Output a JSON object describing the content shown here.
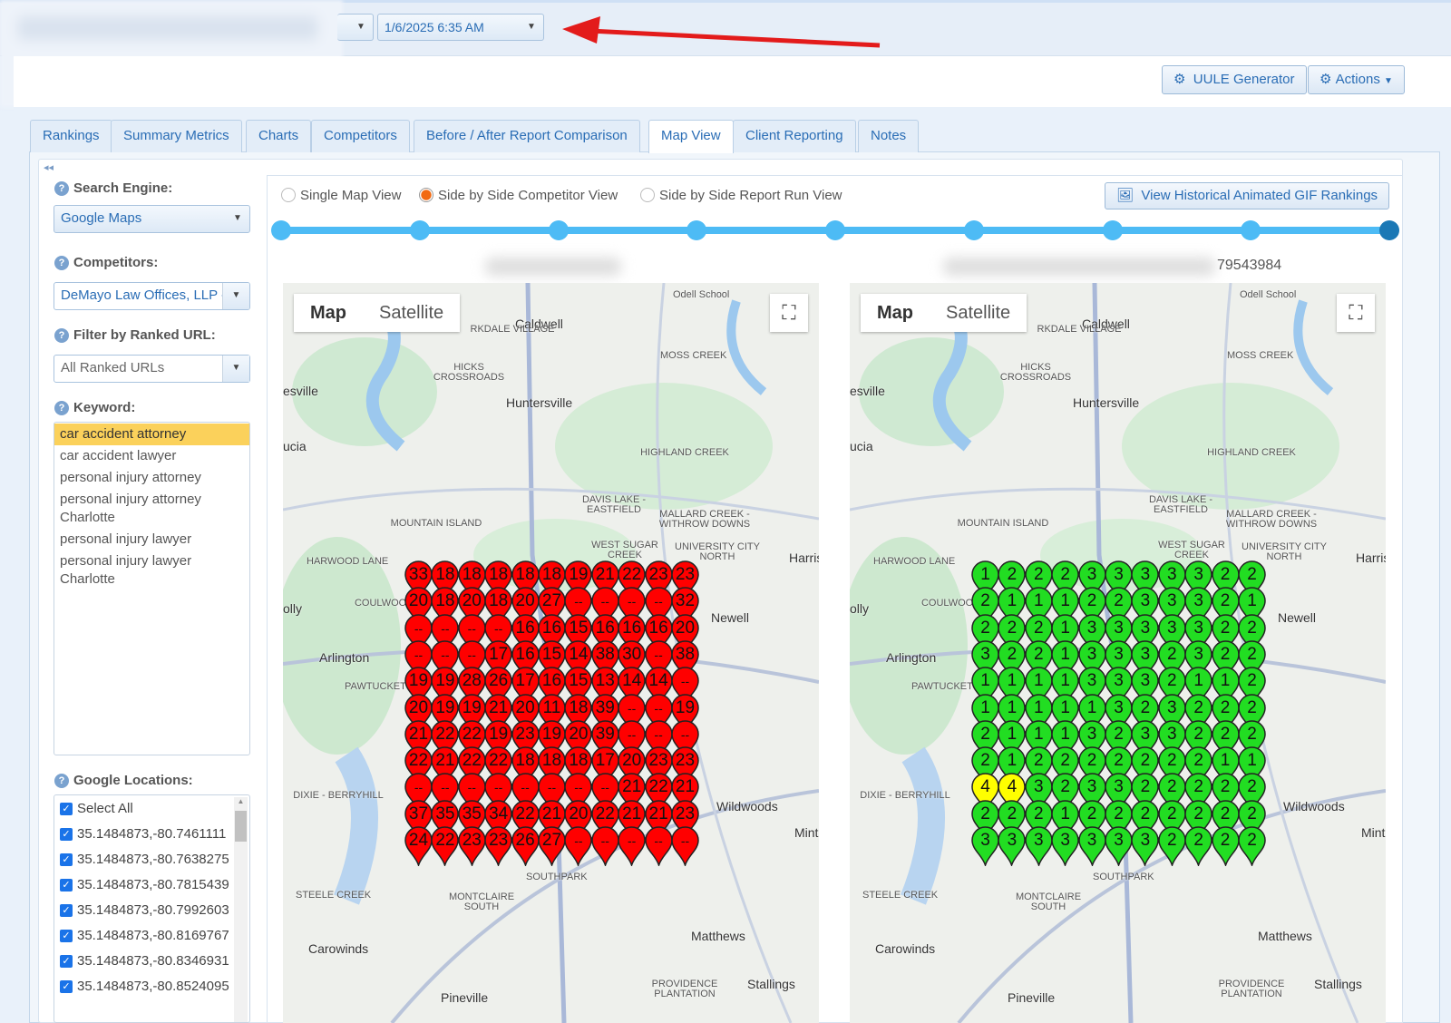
{
  "topbar": {
    "report_date": "1/6/2025 6:35 AM"
  },
  "header": {
    "uule_button": "UULE Generator",
    "actions_button": "Actions"
  },
  "tabs": [
    "Rankings",
    "Summary Metrics",
    "Charts",
    "Competitors",
    "Before / After Report Comparison",
    "Map View",
    "Client Reporting",
    "Notes"
  ],
  "active_tab": "Map View",
  "sidebar": {
    "search_engine_label": "Search Engine:",
    "search_engine_value": "Google Maps",
    "competitors_label": "Competitors:",
    "competitors_value": "DeMayo Law Offices, LLP -",
    "ranked_url_label": "Filter by Ranked URL:",
    "ranked_url_value": "All Ranked URLs",
    "keyword_label": "Keyword:",
    "keywords": [
      "car accident attorney",
      "car accident lawyer",
      "personal injury attorney",
      "personal injury attorney Charlotte",
      "personal injury lawyer",
      "personal injury lawyer Charlotte"
    ],
    "selected_keyword": "car accident attorney",
    "locations_label": "Google Locations:",
    "select_all": "Select All",
    "locations": [
      "35.1484873,-80.7461111",
      "35.1484873,-80.7638275",
      "35.1484873,-80.7815439",
      "35.1484873,-80.7992603",
      "35.1484873,-80.8169767",
      "35.1484873,-80.8346931",
      "35.1484873,-80.8524095"
    ]
  },
  "view": {
    "options": [
      "Single Map View",
      "Side by Side Competitor View",
      "Side by Side Report Run View"
    ],
    "selected": "Side by Side Competitor View",
    "gif_button": "View Historical Animated GIF Rankings",
    "timeline_points": 9,
    "timeline_selected": 9
  },
  "map_controls": {
    "map": "Map",
    "satellite": "Satellite"
  },
  "map_labels": [
    "Odell School",
    "Caldwell",
    "MOSS CREEK",
    "HICKS CROSSROADS",
    "Huntersville",
    "esville",
    "HIGHLAND CREEK",
    "DAVIS LAKE - EASTFIELD",
    "MALLARD CREEK - WITHROW DOWNS",
    "MOUNTAIN ISLAND",
    "WEST SUGAR CREEK",
    "UNIVERSITY CITY NORTH",
    "HARWOOD LANE",
    "Harris",
    "Newell",
    "Arlington",
    "Wildwoods",
    "DIXIE - BERRYHILL",
    "STEELE CREEK",
    "MONTCLAIRE SOUTH",
    "SOUTHPARK",
    "Matthews",
    "Carowinds",
    "PROVIDENCE PLANTATION",
    "Stallings",
    "Pineville",
    "ucia",
    "olly",
    "COULWOOD WEST",
    "PAWTUCKET",
    "Mint",
    "RKDALE VILLAGE"
  ],
  "maps": [
    {
      "caption": "",
      "pin_color": "#ff0000",
      "grid": [
        [
          "33",
          "18",
          "18",
          "18",
          "18",
          "18",
          "19",
          "21",
          "22",
          "23",
          "23"
        ],
        [
          "20",
          "18",
          "20",
          "18",
          "20",
          "27",
          "--",
          "--",
          "--",
          "--",
          "32"
        ],
        [
          "--",
          "--",
          "--",
          "--",
          "16",
          "16",
          "15",
          "16",
          "16",
          "16",
          "20"
        ],
        [
          "--",
          "--",
          "--",
          "17",
          "16",
          "15",
          "14",
          "38",
          "30",
          "--",
          "38"
        ],
        [
          "19",
          "19",
          "28",
          "26",
          "17",
          "16",
          "15",
          "13",
          "14",
          "14",
          "--"
        ],
        [
          "20",
          "19",
          "19",
          "21",
          "20",
          "11",
          "18",
          "39",
          "--",
          "--",
          "19"
        ],
        [
          "21",
          "22",
          "22",
          "19",
          "23",
          "19",
          "20",
          "39",
          "--",
          "--",
          "--"
        ],
        [
          "22",
          "21",
          "22",
          "22",
          "18",
          "18",
          "18",
          "17",
          "20",
          "23",
          "23"
        ],
        [
          "--",
          "--",
          "--",
          "--",
          "--",
          "--",
          "--",
          "--",
          "21",
          "22",
          "21"
        ],
        [
          "37",
          "35",
          "35",
          "34",
          "22",
          "21",
          "20",
          "22",
          "21",
          "21",
          "23"
        ],
        [
          "24",
          "22",
          "23",
          "23",
          "26",
          "27",
          "--",
          "--",
          "--",
          "--",
          "--"
        ]
      ]
    },
    {
      "caption": "79543984",
      "pin_color": "#22dd22",
      "pin_color_rank4": "#ffff00",
      "grid": [
        [
          "1",
          "2",
          "2",
          "2",
          "3",
          "3",
          "3",
          "3",
          "3",
          "2",
          "2"
        ],
        [
          "2",
          "1",
          "1",
          "1",
          "2",
          "2",
          "3",
          "3",
          "3",
          "2",
          "1"
        ],
        [
          "2",
          "2",
          "2",
          "1",
          "3",
          "3",
          "3",
          "3",
          "3",
          "2",
          "2"
        ],
        [
          "3",
          "2",
          "2",
          "1",
          "3",
          "3",
          "3",
          "2",
          "3",
          "2",
          "2"
        ],
        [
          "1",
          "1",
          "1",
          "1",
          "3",
          "3",
          "3",
          "2",
          "1",
          "1",
          "2"
        ],
        [
          "1",
          "1",
          "1",
          "1",
          "1",
          "3",
          "2",
          "3",
          "2",
          "2",
          "2"
        ],
        [
          "2",
          "1",
          "1",
          "1",
          "3",
          "2",
          "3",
          "3",
          "2",
          "2",
          "2"
        ],
        [
          "2",
          "1",
          "2",
          "2",
          "2",
          "2",
          "2",
          "2",
          "2",
          "1",
          "1"
        ],
        [
          "4",
          "4",
          "3",
          "2",
          "3",
          "3",
          "2",
          "2",
          "2",
          "2",
          "2"
        ],
        [
          "2",
          "2",
          "2",
          "1",
          "2",
          "2",
          "2",
          "2",
          "2",
          "2",
          "2"
        ],
        [
          "3",
          "3",
          "3",
          "3",
          "3",
          "3",
          "3",
          "2",
          "2",
          "2",
          "2"
        ]
      ]
    }
  ]
}
